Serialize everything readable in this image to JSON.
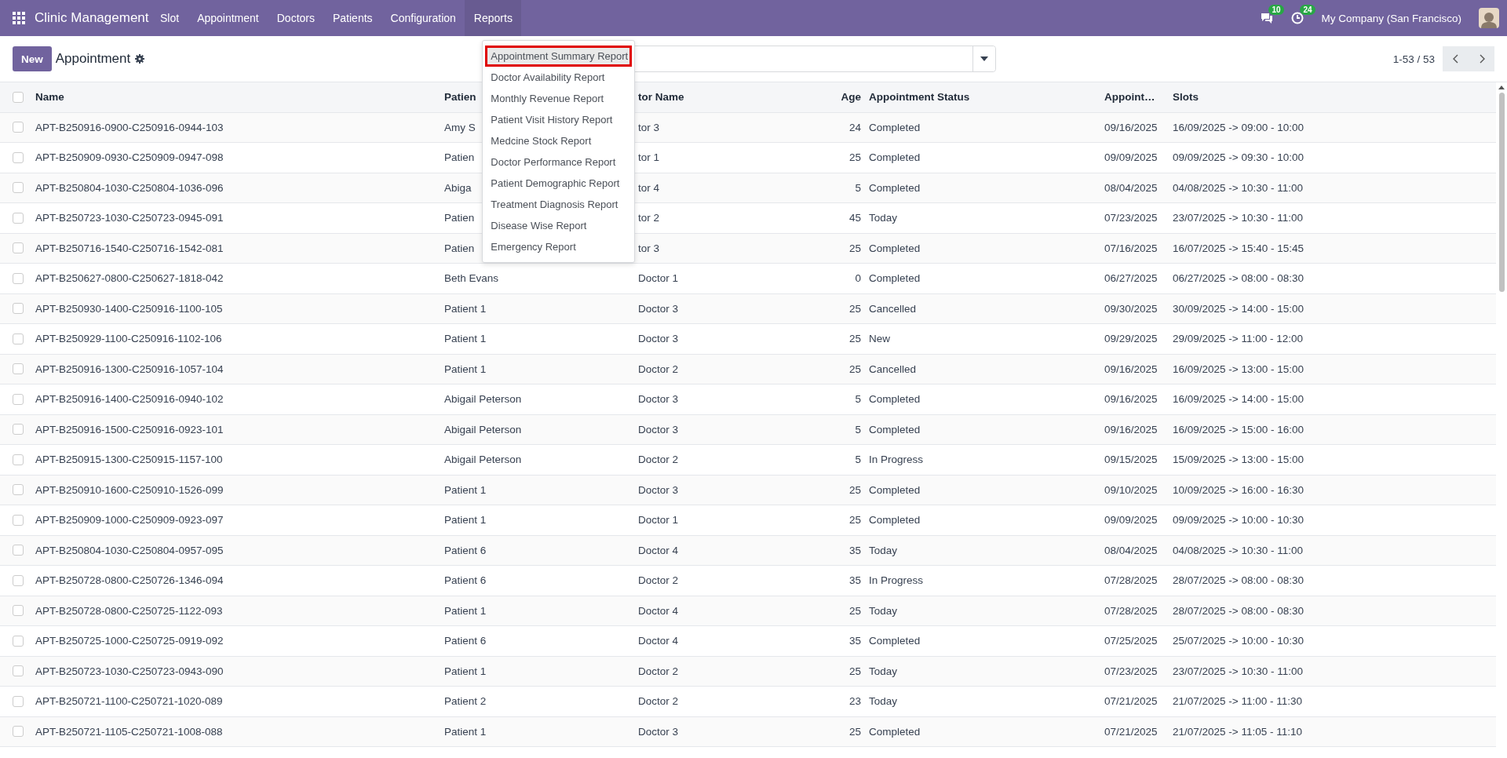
{
  "navbar": {
    "app_name": "Clinic Management",
    "menu": [
      {
        "label": "Slot",
        "selected": false
      },
      {
        "label": "Appointment",
        "selected": false
      },
      {
        "label": "Doctors",
        "selected": false
      },
      {
        "label": "Patients",
        "selected": false
      },
      {
        "label": "Configuration",
        "selected": false
      },
      {
        "label": "Reports",
        "selected": true
      }
    ],
    "messages_count": "10",
    "activities_count": "24",
    "company": "My Company (San Francisco)"
  },
  "reports_menu": [
    {
      "label": "Appointment Summary Report",
      "selected": true
    },
    {
      "label": "Doctor Availability Report",
      "selected": false
    },
    {
      "label": "Monthly Revenue Report",
      "selected": false
    },
    {
      "label": "Patient Visit History Report",
      "selected": false
    },
    {
      "label": "Medcine Stock Report",
      "selected": false
    },
    {
      "label": "Doctor Performance Report",
      "selected": false
    },
    {
      "label": "Patient Demographic Report",
      "selected": false
    },
    {
      "label": "Treatment Diagnosis Report",
      "selected": false
    },
    {
      "label": "Disease Wise Report",
      "selected": false
    },
    {
      "label": "Emergency Report",
      "selected": false
    }
  ],
  "control_panel": {
    "new_button": "New",
    "breadcrumb": "Appointment",
    "pager": "1-53 / 53"
  },
  "table": {
    "select_all_checked": false,
    "columns": [
      "Name",
      "Patien",
      "tor Name",
      "Age",
      "Appointment Status",
      "Appoint…",
      "Slots"
    ],
    "rows": [
      {
        "checked": false,
        "cells": [
          "APT-B250916-0900-C250916-0944-103",
          "Amy S",
          "tor 3",
          "24",
          "Completed",
          "09/16/2025",
          "16/09/2025 -> 09:00 - 10:00"
        ]
      },
      {
        "checked": false,
        "cells": [
          "APT-B250909-0930-C250909-0947-098",
          "Patien",
          "tor 1",
          "25",
          "Completed",
          "09/09/2025",
          "09/09/2025 -> 09:30 - 10:00"
        ]
      },
      {
        "checked": false,
        "cells": [
          "APT-B250804-1030-C250804-1036-096",
          "Abiga",
          "tor 4",
          "5",
          "Completed",
          "08/04/2025",
          "04/08/2025 -> 10:30 - 11:00"
        ]
      },
      {
        "checked": false,
        "cells": [
          "APT-B250723-1030-C250723-0945-091",
          "Patien",
          "tor 2",
          "45",
          "Today",
          "07/23/2025",
          "23/07/2025 -> 10:30 - 11:00"
        ]
      },
      {
        "checked": false,
        "cells": [
          "APT-B250716-1540-C250716-1542-081",
          "Patien",
          "tor 3",
          "25",
          "Completed",
          "07/16/2025",
          "16/07/2025 -> 15:40 - 15:45"
        ]
      },
      {
        "checked": false,
        "cells": [
          "APT-B250627-0800-C250627-1818-042",
          "Beth Evans",
          "Doctor 1",
          "0",
          "Completed",
          "06/27/2025",
          "06/27/2025 -> 08:00 - 08:30"
        ]
      },
      {
        "checked": false,
        "cells": [
          "APT-B250930-1400-C250916-1100-105",
          "Patient 1",
          "Doctor 3",
          "25",
          "Cancelled",
          "09/30/2025",
          "30/09/2025 -> 14:00 - 15:00"
        ]
      },
      {
        "checked": false,
        "cells": [
          "APT-B250929-1100-C250916-1102-106",
          "Patient 1",
          "Doctor 3",
          "25",
          "New",
          "09/29/2025",
          "29/09/2025 -> 11:00 - 12:00"
        ]
      },
      {
        "checked": false,
        "cells": [
          "APT-B250916-1300-C250916-1057-104",
          "Patient 1",
          "Doctor 2",
          "25",
          "Cancelled",
          "09/16/2025",
          "16/09/2025 -> 13:00 - 15:00"
        ]
      },
      {
        "checked": false,
        "cells": [
          "APT-B250916-1400-C250916-0940-102",
          "Abigail Peterson",
          "Doctor 3",
          "5",
          "Completed",
          "09/16/2025",
          "16/09/2025 -> 14:00 - 15:00"
        ]
      },
      {
        "checked": false,
        "cells": [
          "APT-B250916-1500-C250916-0923-101",
          "Abigail Peterson",
          "Doctor 3",
          "5",
          "Completed",
          "09/16/2025",
          "16/09/2025 -> 15:00 - 16:00"
        ]
      },
      {
        "checked": false,
        "cells": [
          "APT-B250915-1300-C250915-1157-100",
          "Abigail Peterson",
          "Doctor 2",
          "5",
          "In Progress",
          "09/15/2025",
          "15/09/2025 -> 13:00 - 15:00"
        ]
      },
      {
        "checked": false,
        "cells": [
          "APT-B250910-1600-C250910-1526-099",
          "Patient 1",
          "Doctor 3",
          "25",
          "Completed",
          "09/10/2025",
          "10/09/2025 -> 16:00 - 16:30"
        ]
      },
      {
        "checked": false,
        "cells": [
          "APT-B250909-1000-C250909-0923-097",
          "Patient 1",
          "Doctor 1",
          "25",
          "Completed",
          "09/09/2025",
          "09/09/2025 -> 10:00 - 10:30"
        ]
      },
      {
        "checked": false,
        "cells": [
          "APT-B250804-1030-C250804-0957-095",
          "Patient 6",
          "Doctor 4",
          "35",
          "Today",
          "08/04/2025",
          "04/08/2025 -> 10:30 - 11:00"
        ]
      },
      {
        "checked": false,
        "cells": [
          "APT-B250728-0800-C250726-1346-094",
          "Patient 6",
          "Doctor 2",
          "35",
          "In Progress",
          "07/28/2025",
          "28/07/2025 -> 08:00 - 08:30"
        ]
      },
      {
        "checked": false,
        "cells": [
          "APT-B250728-0800-C250725-1122-093",
          "Patient 1",
          "Doctor 4",
          "25",
          "Today",
          "07/28/2025",
          "28/07/2025 -> 08:00 - 08:30"
        ]
      },
      {
        "checked": false,
        "cells": [
          "APT-B250725-1000-C250725-0919-092",
          "Patient 6",
          "Doctor 4",
          "35",
          "Completed",
          "07/25/2025",
          "25/07/2025 -> 10:00 - 10:30"
        ]
      },
      {
        "checked": false,
        "cells": [
          "APT-B250723-1030-C250723-0943-090",
          "Patient 1",
          "Doctor 2",
          "25",
          "Today",
          "07/23/2025",
          "23/07/2025 -> 10:30 - 11:00"
        ]
      },
      {
        "checked": false,
        "cells": [
          "APT-B250721-1100-C250721-1020-089",
          "Patient 2",
          "Doctor 2",
          "23",
          "Today",
          "07/21/2025",
          "21/07/2025 -> 11:00 - 11:30"
        ]
      },
      {
        "checked": false,
        "cells": [
          "APT-B250721-1105-C250721-1008-088",
          "Patient 1",
          "Doctor 3",
          "25",
          "Completed",
          "07/21/2025",
          "21/07/2025 -> 11:05 - 11:10"
        ]
      }
    ]
  }
}
